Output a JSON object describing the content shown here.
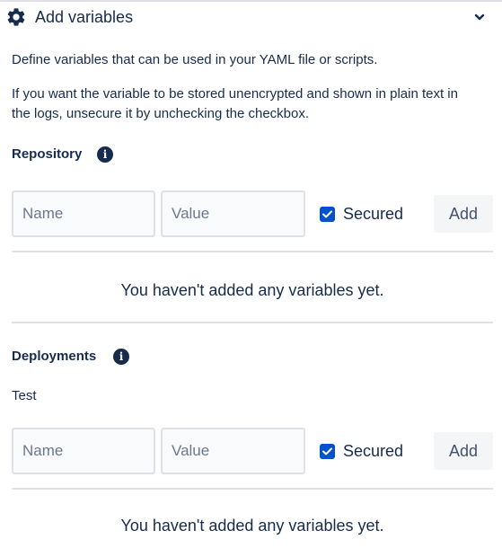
{
  "header": {
    "title": "Add variables",
    "gear_icon": "gear-icon",
    "chevron_icon": "chevron-down-icon"
  },
  "description": {
    "line1": "Define variables that can be used in your YAML file or scripts.",
    "line2": "If you want the variable to be stored unencrypted and shown in plain text in the logs, unsecure it by unchecking the checkbox."
  },
  "repository": {
    "title": "Repository",
    "info_icon": "info-icon",
    "name_placeholder": "Name",
    "value_placeholder": "Value",
    "secured_checked": true,
    "secured_label": "Secured",
    "add_label": "Add",
    "empty_message": "You haven't added any variables yet."
  },
  "deployments": {
    "title": "Deployments",
    "info_icon": "info-icon",
    "environment": "Test",
    "name_placeholder": "Name",
    "value_placeholder": "Value",
    "secured_checked": true,
    "secured_label": "Secured",
    "add_label": "Add",
    "empty_message": "You haven't added any variables yet."
  },
  "colors": {
    "text": "#172b4d",
    "checkbox": "#0052cc",
    "border": "#dfe1e6",
    "button_bg": "#f4f5f7"
  }
}
